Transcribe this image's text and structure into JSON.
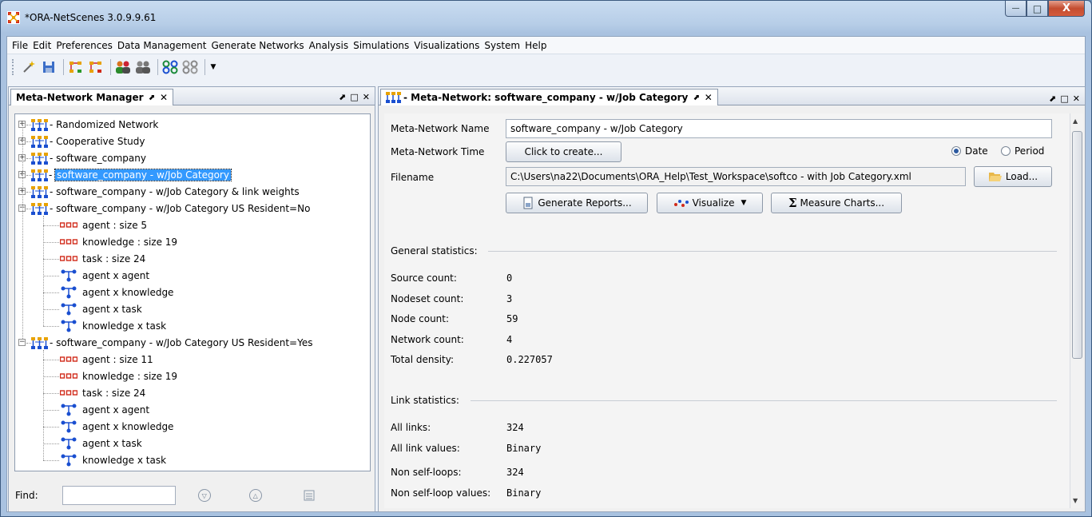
{
  "window": {
    "title": "*ORA-NetScenes 3.0.9.9.61",
    "controls": {
      "minimize": "—",
      "maximize": "□",
      "close": "X"
    }
  },
  "menubar": [
    "File",
    "Edit",
    "Preferences",
    "Data Management",
    "Generate Networks",
    "Analysis",
    "Simulations",
    "Visualizations",
    "System",
    "Help"
  ],
  "left_panel": {
    "tab_label": "Meta-Network Manager",
    "pin": "⬈",
    "close": "✕",
    "ctrl_pin": "⬈",
    "ctrl_max": "□",
    "ctrl_close": "✕",
    "tree": [
      {
        "label": "- Randomized Network",
        "expanded": false
      },
      {
        "label": "- Cooperative Study",
        "expanded": false
      },
      {
        "label": "- software_company",
        "expanded": false
      },
      {
        "prefix": "- ",
        "label": "software_company - w/Job Category",
        "expanded": false,
        "selected": true
      },
      {
        "label": "- software_company - w/Job Category & link weights",
        "expanded": false
      },
      {
        "label": "- software_company - w/Job Category US Resident=No",
        "expanded": true,
        "children": [
          {
            "kind": "nodeset",
            "label": "agent : size 5"
          },
          {
            "kind": "nodeset",
            "label": "knowledge : size 19"
          },
          {
            "kind": "nodeset",
            "label": "task : size 24"
          },
          {
            "kind": "network",
            "label": "agent x agent"
          },
          {
            "kind": "network",
            "label": "agent x knowledge"
          },
          {
            "kind": "network",
            "label": "agent x task"
          },
          {
            "kind": "network",
            "label": "knowledge x task"
          }
        ]
      },
      {
        "label": "- software_company - w/Job Category US Resident=Yes",
        "expanded": true,
        "children": [
          {
            "kind": "nodeset",
            "label": "agent : size 11"
          },
          {
            "kind": "nodeset",
            "label": "knowledge : size 19"
          },
          {
            "kind": "nodeset",
            "label": "task : size 24"
          },
          {
            "kind": "network",
            "label": "agent x agent"
          },
          {
            "kind": "network",
            "label": "agent x knowledge"
          },
          {
            "kind": "network",
            "label": "agent x task"
          },
          {
            "kind": "network",
            "label": "knowledge x task"
          }
        ]
      }
    ],
    "find": {
      "label": "Find:",
      "value": ""
    }
  },
  "right_panel": {
    "tab_label": "- Meta-Network: software_company - w/Job Category",
    "pin": "⬈",
    "close": "✕",
    "ctrl_pin": "⬈",
    "ctrl_max": "□",
    "ctrl_close": "✕",
    "name_label": "Meta-Network Name",
    "name_value": "software_company - w/Job Category",
    "time_label": "Meta-Network Time",
    "time_button": "Click to create...",
    "radio_date": "Date",
    "radio_period": "Period",
    "filename_label": "Filename",
    "filename_value": "C:\\Users\\na22\\Documents\\ORA_Help\\Test_Workspace\\softco - with Job Category.xml",
    "load_button": "Load...",
    "generate_reports": "Generate Reports...",
    "visualize": "Visualize",
    "measure_charts": "Measure Charts...",
    "general_title": "General statistics:",
    "general_stats": [
      {
        "label": "Source count:",
        "value": "0"
      },
      {
        "label": "Nodeset count:",
        "value": "3"
      },
      {
        "label": "Node count:",
        "value": "59"
      },
      {
        "label": "Network count:",
        "value": "4"
      },
      {
        "label": "Total density:",
        "value": "0.227057"
      }
    ],
    "link_title": "Link statistics:",
    "link_stats": [
      {
        "label": "All links:",
        "value": "324"
      },
      {
        "label": "All link values:",
        "value": "Binary"
      }
    ],
    "loop_stats": [
      {
        "label": "Non self-loops:",
        "value": "324"
      },
      {
        "label": "Non self-loop values:",
        "value": "Binary"
      }
    ]
  },
  "colors": {
    "selection": "#3399ff",
    "icon_orange": "#e8a200",
    "icon_blue": "#1a4fd0",
    "icon_red": "#d12a1a"
  }
}
